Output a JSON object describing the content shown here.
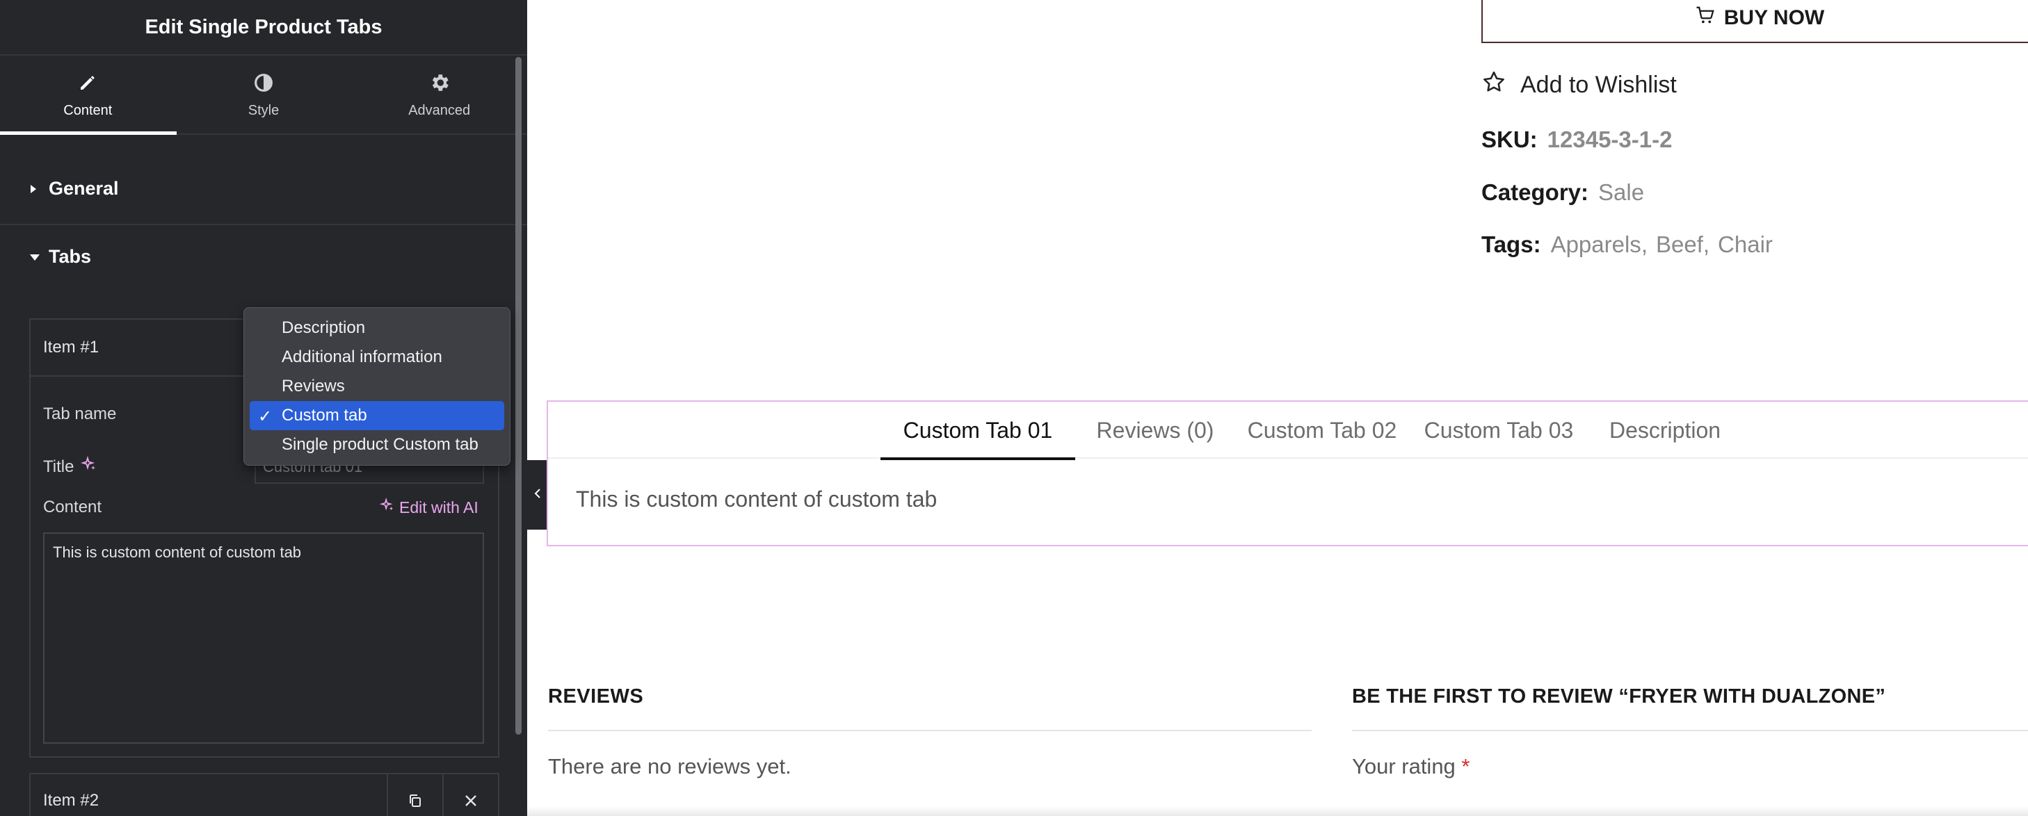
{
  "panel": {
    "title": "Edit Single Product Tabs",
    "tabs": [
      {
        "label": "Content",
        "icon": "pencil-icon",
        "active": true
      },
      {
        "label": "Style",
        "icon": "contrast-icon",
        "active": false
      },
      {
        "label": "Advanced",
        "icon": "gear-icon",
        "active": false
      }
    ],
    "sections": {
      "general": "General",
      "tabs": "Tabs"
    },
    "item1": {
      "label": "Item #1",
      "tab_name_label": "Tab name",
      "title_label": "Title",
      "title_value": "Custom tab 01",
      "content_label": "Content",
      "edit_ai_label": "Edit with AI",
      "content_value": "This is custom content of custom tab"
    },
    "item2": {
      "label": "Item #2"
    },
    "dropdown": {
      "options": [
        "Description",
        "Additional information",
        "Reviews",
        "Custom tab",
        "Single product Custom tab"
      ],
      "selected": "Custom tab",
      "check": "✓"
    }
  },
  "product": {
    "buy_now_label": "BUY NOW",
    "wishlist_label": "Add to Wishlist",
    "sku_label": "SKU:",
    "sku_value": "12345-3-1-2",
    "category_label": "Category:",
    "category_value": "Sale",
    "tags_label": "Tags:",
    "tags": [
      "Apparels",
      "Beef",
      "Chair"
    ],
    "tag_separator": ","
  },
  "product_tabs": {
    "tabs": [
      "Custom Tab 01",
      "Reviews (0)",
      "Custom Tab 02",
      "Custom Tab 03",
      "Description"
    ],
    "active_index": 0,
    "content": "This is custom content of custom tab"
  },
  "reviews": {
    "heading": "REVIEWS",
    "empty_text": "There are no reviews yet.",
    "form_heading": "BE THE FIRST TO REVIEW “FRYER WITH DUALZONE”",
    "rating_label": "Your rating",
    "required_mark": "*"
  },
  "colors": {
    "panel_bg": "#26272b",
    "accent_ai": "#e9a7ee",
    "selected_option": "#2a5fd8",
    "widget_border": "#e7b5eb",
    "required": "#d32f2f"
  }
}
